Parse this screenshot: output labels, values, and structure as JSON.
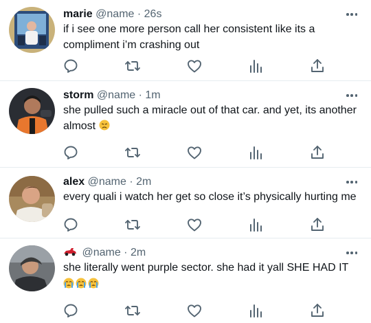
{
  "tweets": [
    {
      "name": "marie",
      "handle": "@name",
      "dot": "·",
      "time": "26s",
      "lines": [
        "if i see one more person call her consistent like its a",
        "compliment i’m crashing out"
      ]
    },
    {
      "name": "storm",
      "handle": "@name",
      "dot": "·",
      "time": "1m",
      "lines": [
        "she pulled such a miracle out of that car. and yet, its another",
        "almost "
      ]
    },
    {
      "name": "alex",
      "handle": "@name",
      "dot": "·",
      "time": "2m",
      "lines": [
        "every quali i watch her get so close it’s physically hurting me"
      ]
    },
    {
      "name": "",
      "handle": "@name",
      "dot": "·",
      "time": "2m",
      "lines": [
        "she literally went purple sector. she had it yall SHE HAD IT"
      ]
    }
  ],
  "icons": {
    "reply": "reply-icon",
    "retweet": "retweet-icon",
    "like": "heart-icon",
    "views": "analytics-icon",
    "share": "share-icon",
    "more": "more-icon",
    "name_emoji": "race-car-icon"
  },
  "colors": {
    "text": "#0f1419",
    "secondary": "#536471",
    "divider": "#e6ecf0",
    "emoji_yellow": "#f7c23c",
    "race_car_red": "#d1202f"
  }
}
